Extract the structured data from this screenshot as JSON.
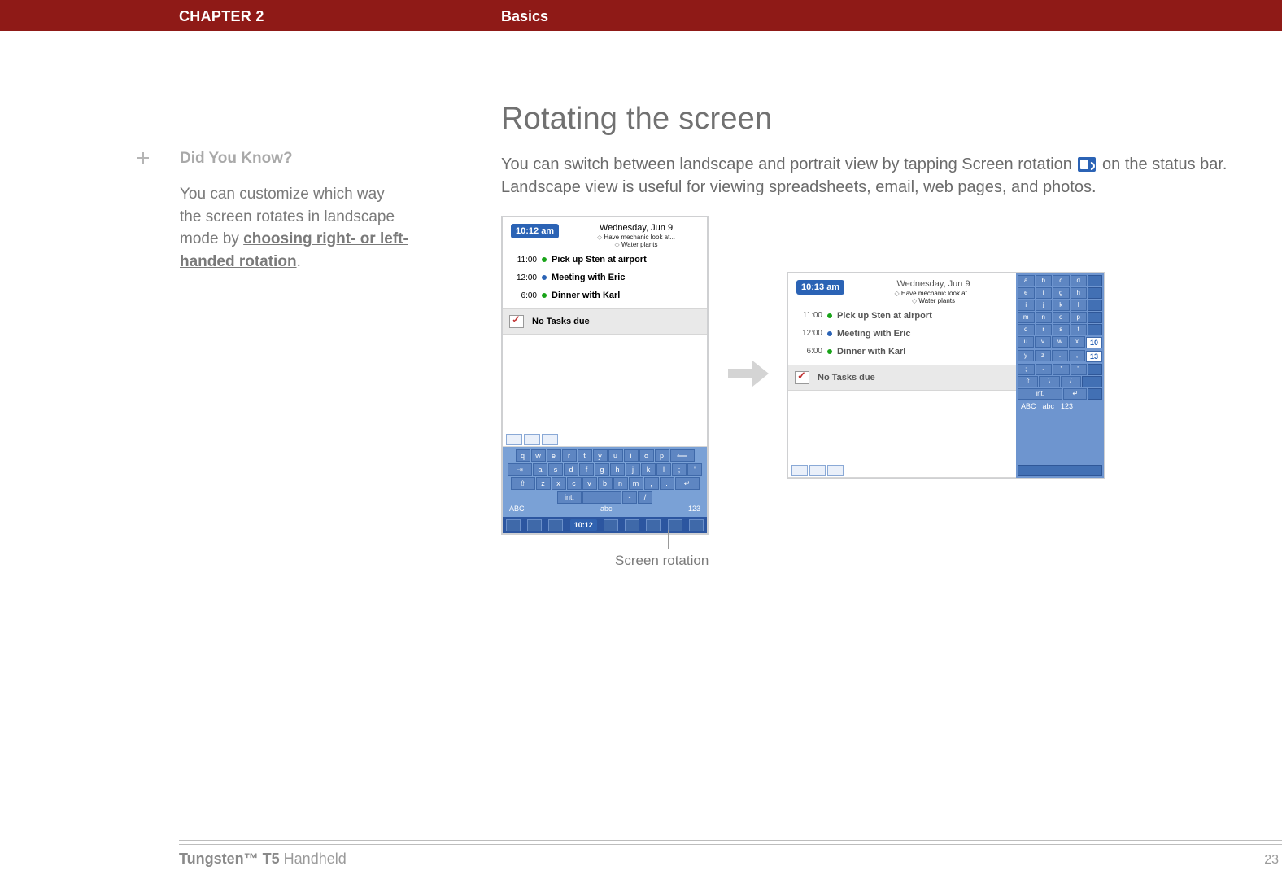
{
  "header": {
    "chapter": "CHAPTER 2",
    "section": "Basics"
  },
  "sidebar": {
    "title": "Did You Know?",
    "body_pre": "You can customize which way the screen rotates in landscape mode by ",
    "body_link": "choosing right- or left-handed rotation",
    "body_post": "."
  },
  "main": {
    "title": "Rotating the screen",
    "lead_a": "You can switch between landscape and portrait view by tapping Screen rotation ",
    "lead_b": " on the status bar. Landscape view is useful for viewing spreadsheets, email, web pages, and photos."
  },
  "callout": "Screen rotation",
  "portrait": {
    "time": "10:12 am",
    "date": "Wednesday, Jun 9",
    "sub1": "Have mechanic look at...",
    "sub2": "Water plants",
    "rows": [
      {
        "t": "11:00",
        "txt": "Pick up Sten at airport",
        "dot": "green"
      },
      {
        "t": "12:00",
        "txt": "Meeting with Eric",
        "dot": "blue"
      },
      {
        "t": "6:00",
        "txt": "Dinner with Karl",
        "dot": "green"
      }
    ],
    "tasks": "No Tasks due",
    "kbd": {
      "r1": [
        "q",
        "w",
        "e",
        "r",
        "t",
        "y",
        "u",
        "i",
        "o",
        "p",
        "⟵"
      ],
      "r2": [
        "⇥",
        "a",
        "s",
        "d",
        "f",
        "g",
        "h",
        "j",
        "k",
        "l",
        ";",
        "'"
      ],
      "r3": [
        "⇧",
        "z",
        "x",
        "c",
        "v",
        "b",
        "n",
        "m",
        ",",
        ".",
        "↵"
      ],
      "r4_int": "int.",
      "labels": {
        "l": "ABC",
        "m": "abc",
        "r": "123"
      },
      "clock": "10:12"
    }
  },
  "landscape": {
    "time": "10:13 am",
    "date": "Wednesday, Jun 9",
    "sub1": "Have mechanic look at...",
    "sub2": "Water plants",
    "rows": [
      {
        "t": "11:00",
        "txt": "Pick up Sten at airport",
        "dot": "green"
      },
      {
        "t": "12:00",
        "txt": "Meeting with Eric",
        "dot": "blue"
      },
      {
        "t": "6:00",
        "txt": "Dinner with Karl",
        "dot": "green"
      }
    ],
    "tasks": "No Tasks due",
    "kbd": {
      "rows": [
        [
          "a",
          "b",
          "c",
          "d"
        ],
        [
          "e",
          "f",
          "g",
          "h"
        ],
        [
          "i",
          "j",
          "k",
          "l"
        ],
        [
          "m",
          "n",
          "o",
          "p"
        ],
        [
          "q",
          "r",
          "s",
          "t"
        ],
        [
          "u",
          "v",
          "w",
          "x"
        ],
        [
          "y",
          "z",
          ".",
          ","
        ],
        [
          ";",
          "-",
          "'",
          "\""
        ]
      ],
      "nav": [
        "⇧",
        "\\",
        "/"
      ],
      "int": "int.",
      "enter": "↵",
      "clock_top": "10",
      "clock_bot": "13",
      "labels": {
        "l": "ABC",
        "m": "abc",
        "r": "123"
      }
    }
  },
  "footer": {
    "product_bold": "Tungsten™ T5",
    "product_rest": " Handheld",
    "page": "23"
  }
}
